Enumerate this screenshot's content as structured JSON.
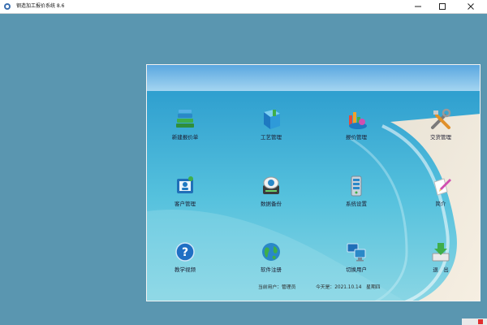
{
  "window": {
    "title": "钢造加工报价系统 8.6"
  },
  "tiles": [
    {
      "label": "新建报价单",
      "icon": "books-icon"
    },
    {
      "label": "工艺管理",
      "icon": "book-icon"
    },
    {
      "label": "报价管理",
      "icon": "chart-icon"
    },
    {
      "label": "交货管理",
      "icon": "tools-icon"
    },
    {
      "label": "客户管理",
      "icon": "contacts-icon"
    },
    {
      "label": "数据备份",
      "icon": "disk-icon"
    },
    {
      "label": "系统设置",
      "icon": "server-icon"
    },
    {
      "label": "简介",
      "icon": "note-icon"
    },
    {
      "label": "教学视频",
      "icon": "help-icon"
    },
    {
      "label": "软件注册",
      "icon": "globe-icon"
    },
    {
      "label": "切换用户",
      "icon": "monitors-icon"
    },
    {
      "label": "退　出",
      "icon": "exit-icon"
    }
  ],
  "status": {
    "user": "当前用户：管理员",
    "date": "今天是：2021.10.14　星期四"
  }
}
